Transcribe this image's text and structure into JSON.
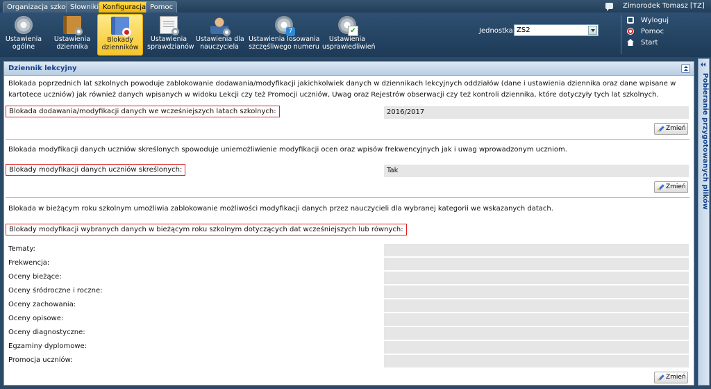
{
  "menu": {
    "tabs": [
      {
        "label": "Organizacja szkoły"
      },
      {
        "label": "Słowniki"
      },
      {
        "label": "Konfiguracja",
        "active": true
      },
      {
        "label": "Pomoc"
      }
    ]
  },
  "user": {
    "name": "Zimorodek Tomasz [TZ]"
  },
  "toolbar": {
    "buttons": [
      {
        "line1": "Ustawienia",
        "line2": "ogólne",
        "icon": "gear-icon"
      },
      {
        "line1": "Ustawienia",
        "line2": "dziennika",
        "icon": "journal-settings-icon"
      },
      {
        "line1": "Blokady",
        "line2": "dzienników",
        "icon": "journal-lock-icon",
        "active": true
      },
      {
        "line1": "Ustawienia",
        "line2": "sprawdzianów",
        "icon": "test-settings-icon"
      },
      {
        "line1": "Ustawienia dla",
        "line2": "nauczyciela",
        "icon": "teacher-settings-icon"
      },
      {
        "line1": "Ustawienia losowania",
        "line2": "szczęśliwego numeru",
        "icon": "lucky-number-icon"
      },
      {
        "line1": "Ustawienia",
        "line2": "usprawiedliwień",
        "icon": "excuses-settings-icon"
      }
    ],
    "unit_label": "Jednostka:",
    "unit_value": "ZS2",
    "links": {
      "logout": "Wyloguj",
      "help": "Pomoc",
      "start": "Start"
    }
  },
  "panel": {
    "title": "Dziennik lekcyjny",
    "section1": {
      "description": "Blokada poprzednich lat szkolnych powoduje zablokowanie dodawania/modyfikacji jakichkolwiek danych w dziennikach lekcyjnych oddziałów (dane i ustawienia dziennika oraz dane wpisane w kartotece uczniów) jak również danych wpisanych w widoku Lekcji czy też Promocji uczniów, Uwag oraz Rejestrów obserwacji czy też kontroli dziennika, które dotyczyły tych lat szkolnych.",
      "label": "Blokada dodawania/modyfikacji danych we wcześniejszych latach szkolnych:",
      "value": "2016/2017",
      "button": "Zmień"
    },
    "section2": {
      "description": "Blokada modyfikacji danych uczniów skreślonych spowoduje uniemożliwienie modyfikacji ocen oraz wpisów frekwencyjnych jak i uwag wprowadzonym uczniom.",
      "label": "Blokady modyfikacji danych uczniów skreślonych:",
      "value": "Tak",
      "button": "Zmień"
    },
    "section3": {
      "description": "Blokada w bieżącym roku szkolnym umożliwia zablokowanie możliwości modyfikacji danych przez nauczycieli dla wybranej kategorii we wskazanych datach.",
      "label": "Blokady modyfikacji wybranych danych w bieżącym roku szkolnym dotyczących dat wcześniejszych lub równych:",
      "rows": [
        {
          "label": "Tematy:",
          "value": ""
        },
        {
          "label": "Frekwencja:",
          "value": ""
        },
        {
          "label": "Oceny bieżące:",
          "value": ""
        },
        {
          "label": "Oceny śródroczne i roczne:",
          "value": ""
        },
        {
          "label": "Oceny zachowania:",
          "value": ""
        },
        {
          "label": "Oceny opisowe:",
          "value": ""
        },
        {
          "label": "Oceny diagnostyczne:",
          "value": ""
        },
        {
          "label": "Egzaminy dyplomowe:",
          "value": ""
        },
        {
          "label": "Promocja uczniów:",
          "value": ""
        }
      ],
      "button": "Zmień"
    }
  },
  "sidebar": {
    "title": "Pobieranie przygotowanych plików"
  },
  "colors": {
    "accent": "#f5c52a",
    "header_bg": "#1d3a57",
    "highlight_border": "#e02020"
  }
}
